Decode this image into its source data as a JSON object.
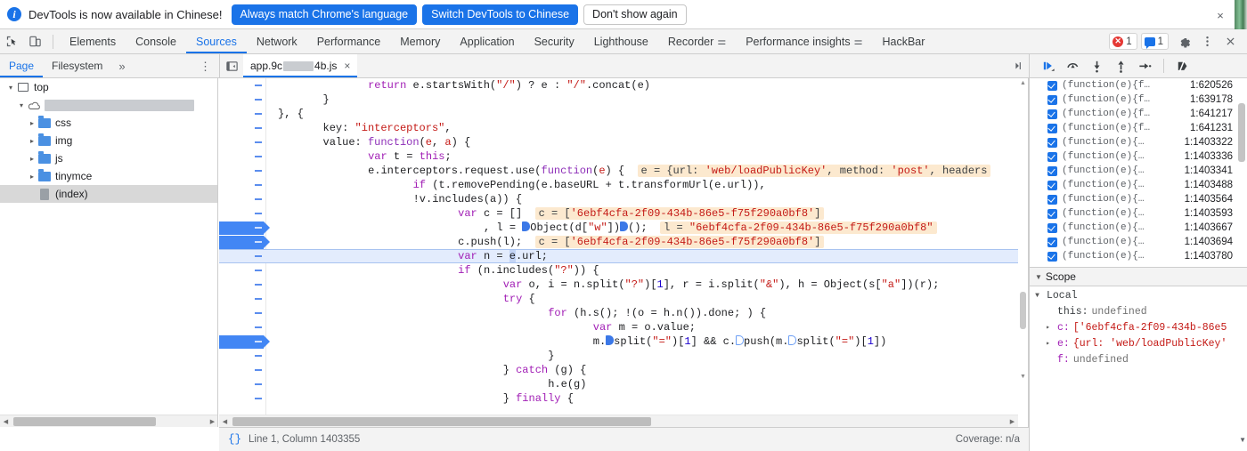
{
  "infobar": {
    "icon": "info-icon",
    "message": "DevTools is now available in Chinese!",
    "primary_buttons": [
      "Always match Chrome's language",
      "Switch DevTools to Chinese"
    ],
    "ghost_button": "Don't show again",
    "close_label": "×"
  },
  "tabstrip": {
    "left_icons": [
      "inspect-element-icon",
      "device-toolbar-icon"
    ],
    "tabs": [
      {
        "label": "Elements",
        "active": false,
        "warn": false
      },
      {
        "label": "Console",
        "active": false,
        "warn": false
      },
      {
        "label": "Sources",
        "active": true,
        "warn": false
      },
      {
        "label": "Network",
        "active": false,
        "warn": false
      },
      {
        "label": "Performance",
        "active": false,
        "warn": false
      },
      {
        "label": "Memory",
        "active": false,
        "warn": false
      },
      {
        "label": "Application",
        "active": false,
        "warn": false
      },
      {
        "label": "Security",
        "active": false,
        "warn": false
      },
      {
        "label": "Lighthouse",
        "active": false,
        "warn": false
      },
      {
        "label": "Recorder",
        "active": false,
        "warn": true
      },
      {
        "label": "Performance insights",
        "active": false,
        "warn": true
      },
      {
        "label": "HackBar",
        "active": false,
        "warn": false
      }
    ],
    "error_badge": {
      "icon": "error-icon",
      "count": "1"
    },
    "message_badge": {
      "icon": "message-icon",
      "count": "1"
    },
    "settings_icon": "gear-icon",
    "more_icon": "kebab-menu-icon",
    "close_icon": "close-icon"
  },
  "navigator": {
    "tabs": [
      {
        "label": "Page",
        "active": true
      },
      {
        "label": "Filesystem",
        "active": false
      }
    ],
    "more_label": "»",
    "kebab_label": "⋮",
    "tree": [
      {
        "label": "top",
        "icon": "frame-icon",
        "indent": 0,
        "twisty": "▾",
        "selected": false,
        "redacted": false
      },
      {
        "label": "",
        "icon": "cloud-icon",
        "indent": 1,
        "twisty": "▾",
        "selected": false,
        "redacted": true,
        "redact_width": 168
      },
      {
        "label": "css",
        "icon": "folder-icon",
        "indent": 2,
        "twisty": "▸",
        "selected": false,
        "redacted": false
      },
      {
        "label": "img",
        "icon": "folder-icon",
        "indent": 2,
        "twisty": "▸",
        "selected": false,
        "redacted": false
      },
      {
        "label": "js",
        "icon": "folder-icon",
        "indent": 2,
        "twisty": "▸",
        "selected": false,
        "redacted": false
      },
      {
        "label": "tinymce",
        "icon": "folder-icon",
        "indent": 2,
        "twisty": "▸",
        "selected": false,
        "redacted": false
      },
      {
        "label": "(index)",
        "icon": "document-icon",
        "indent": 2,
        "twisty": "",
        "selected": true,
        "redacted": false
      }
    ]
  },
  "file_tab": {
    "panel_toggle_icon": "show-navigator-icon",
    "name_prefix": "app.9c",
    "name_suffix": "4b.js",
    "redact_width": 34,
    "close_label": "×",
    "overflow_label": "▸|"
  },
  "debug_toolbar": {
    "buttons": [
      {
        "name": "resume-script-execution-button",
        "glyph": "resume-icon"
      },
      {
        "name": "step-over-next-function-call-button",
        "glyph": "step-over-icon"
      },
      {
        "name": "step-into-next-function-call-button",
        "glyph": "step-into-icon"
      },
      {
        "name": "step-out-of-current-function-button",
        "glyph": "step-out-icon"
      },
      {
        "name": "step-button",
        "glyph": "step-icon"
      },
      {
        "name": "deactivate-breakpoints-button",
        "glyph": "deactivate-breakpoints-icon"
      }
    ]
  },
  "editor": {
    "lines": [
      {
        "indent": 44,
        "html": "<span class=\"kw\">return</span> e.startsWith(<span class=\"str\">\"/\"</span>) ? e : <span class=\"str\">\"/\"</span>.concat(e)",
        "bp": false,
        "hl": false
      },
      {
        "indent": 37,
        "html": "}",
        "bp": false,
        "hl": false
      },
      {
        "indent": 30,
        "html": "}, {",
        "bp": false,
        "hl": false
      },
      {
        "indent": 37,
        "html": "key: <span class=\"str\">\"interceptors\"</span>,",
        "bp": false,
        "hl": false
      },
      {
        "indent": 37,
        "html": "value: <span class=\"fn\">function</span>(<span class=\"param\">e</span>, <span class=\"param\">a</span>) {",
        "bp": false,
        "hl": false
      },
      {
        "indent": 44,
        "html": "<span class=\"kw\">var</span> t = <span class=\"kw\">this</span>;",
        "bp": false,
        "hl": false
      },
      {
        "indent": 44,
        "html": "e.interceptors.request.use(<span class=\"fn\">function</span>(<span class=\"param\">e</span>) {  <span class=\"hint\"><span class=\"hk\">e = {url: </span><span class=\"hv\">'web/loadPublicKey'</span><span class=\"hk\">, method: </span><span class=\"hv\">'post'</span><span class=\"hk\">, headers</span></span>",
        "bp": false,
        "hl": false
      },
      {
        "indent": 51,
        "html": "<span class=\"kw\">if</span> (t.removePending(e.baseURL + t.transformUrl(e.url)),",
        "bp": false,
        "hl": false
      },
      {
        "indent": 51,
        "html": "!v.includes(a)) {",
        "bp": false,
        "hl": false
      },
      {
        "indent": 58,
        "html": "<span class=\"kw\">var</span> c = []  <span class=\"hint\"><span class=\"hk\">c = [</span><span class=\"hv\">'6ebf4cfa-2f09-434b-86e5-f75f290a0bf8'</span><span class=\"hk\">]</span></span>",
        "bp": false,
        "hl": false
      },
      {
        "indent": 62,
        "html": ", l = <span class=\"collapse-box\"></span>Object(d[<span class=\"str\">\"w\"</span>])<span class=\"collapse-box\"></span>();  <span class=\"hint\"><span class=\"hk\">l = </span><span class=\"hv\">\"6ebf4cfa-2f09-434b-86e5-f75f290a0bf8\"</span></span>",
        "bp": true,
        "hl": false
      },
      {
        "indent": 58,
        "html": "c.push(l);  <span class=\"hint\"><span class=\"hk\">c = [</span><span class=\"hv\">'6ebf4cfa-2f09-434b-86e5-f75f290a0bf8'</span><span class=\"hk\">]</span></span>",
        "bp": true,
        "hl": false
      },
      {
        "indent": 58,
        "html": "<span class=\"kw\">var</span> n = <span style=\"background:#c3d4f5\">e</span>.url;",
        "bp": false,
        "hl": true
      },
      {
        "indent": 58,
        "html": "<span class=\"kw\">if</span> (n.includes(<span class=\"str\">\"?\"</span>)) {",
        "bp": false,
        "hl": false
      },
      {
        "indent": 65,
        "html": "<span class=\"kw\">var</span> o, i = n.split(<span class=\"str\">\"?\"</span>)[<span class=\"num\">1</span>], r = i.split(<span class=\"str\">\"&amp;\"</span>), h = Object(s[<span class=\"str\">\"a\"</span>])(r);",
        "bp": false,
        "hl": false
      },
      {
        "indent": 65,
        "html": "<span class=\"kw\">try</span> {",
        "bp": false,
        "hl": false
      },
      {
        "indent": 72,
        "html": "<span class=\"kw\">for</span> (h.s(); !(o = h.n()).done; ) {",
        "bp": false,
        "hl": false
      },
      {
        "indent": 79,
        "html": "<span class=\"kw\">var</span> m = o.value;",
        "bp": false,
        "hl": false
      },
      {
        "indent": 79,
        "html": "m.<span class=\"collapse-box\"></span>split(<span class=\"str\">\"=\"</span>)[<span class=\"num\">1</span>] &amp;&amp; c.<span class=\"collapse-box hollow\"></span>push(m.<span class=\"collapse-box hollow\"></span>split(<span class=\"str\">\"=\"</span>)[<span class=\"num\">1</span>])",
        "bp": true,
        "hl": false
      },
      {
        "indent": 72,
        "html": "}",
        "bp": false,
        "hl": false
      },
      {
        "indent": 65,
        "html": "} <span class=\"kw\">catch</span> (g) {",
        "bp": false,
        "hl": false
      },
      {
        "indent": 72,
        "html": "h.e(g)",
        "bp": false,
        "hl": false
      },
      {
        "indent": 65,
        "html": "} <span class=\"kw\">finally</span> {",
        "bp": false,
        "hl": false
      }
    ]
  },
  "breakpoints": {
    "rows": [
      {
        "label": "(function(e){f…",
        "location": "1:620526",
        "checked": true
      },
      {
        "label": "(function(e){f…",
        "location": "1:639178",
        "checked": true
      },
      {
        "label": "(function(e){f…",
        "location": "1:641217",
        "checked": true
      },
      {
        "label": "(function(e){f…",
        "location": "1:641231",
        "checked": true
      },
      {
        "label": "(function(e){…",
        "location": "1:1403322",
        "checked": true
      },
      {
        "label": "(function(e){…",
        "location": "1:1403336",
        "checked": true
      },
      {
        "label": "(function(e){…",
        "location": "1:1403341",
        "checked": true
      },
      {
        "label": "(function(e){…",
        "location": "1:1403488",
        "checked": true
      },
      {
        "label": "(function(e){…",
        "location": "1:1403564",
        "checked": true
      },
      {
        "label": "(function(e){…",
        "location": "1:1403593",
        "checked": true
      },
      {
        "label": "(function(e){…",
        "location": "1:1403667",
        "checked": true
      },
      {
        "label": "(function(e){…",
        "location": "1:1403694",
        "checked": true
      },
      {
        "label": "(function(e){…",
        "location": "1:1403780",
        "checked": true
      }
    ]
  },
  "scope": {
    "section_title": "Scope",
    "group_title": "Local",
    "rows": [
      {
        "twisty": "",
        "name": "this",
        "sep": ": ",
        "value": "undefined",
        "undef": true,
        "name_plain": true
      },
      {
        "twisty": "▸",
        "name": "c",
        "sep": ": ",
        "value": "['6ebf4cfa-2f09-434b-86e5",
        "undef": false,
        "name_plain": false
      },
      {
        "twisty": "▸",
        "name": "e",
        "sep": ": ",
        "value": "{url: 'web/loadPublicKey'",
        "undef": false,
        "name_plain": false
      },
      {
        "twisty": "",
        "name": "f",
        "sep": ": ",
        "value": "undefined",
        "undef": true,
        "name_plain": false
      }
    ]
  },
  "statusbar": {
    "pretty_print_icon": "{}",
    "position": "Line 1, Column 1403355",
    "coverage": "Coverage: n/a"
  },
  "colors": {
    "accent": "#1a73e8",
    "breakpoint": "#4286f4",
    "highlight_line": "#e3ecfd",
    "value_hint_bg": "#fce9cf",
    "toolbar_bg": "#f3f3f3",
    "string": "#c41a16",
    "keyword": "#a11eb5"
  }
}
